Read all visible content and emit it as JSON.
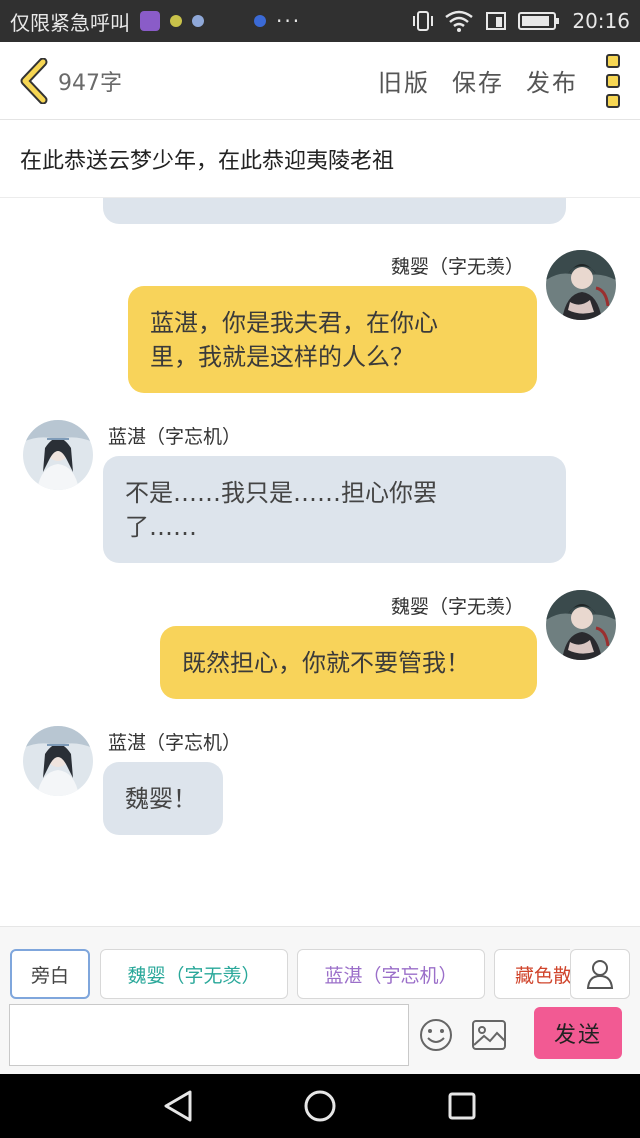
{
  "status_bar": {
    "carrier": "仅限紧急呼叫",
    "more": "···",
    "time": "20:16",
    "battery_level": 0.9
  },
  "toolbar": {
    "word_count": "947字",
    "actions": [
      "旧版",
      "保存",
      "发布"
    ]
  },
  "title": "在此恭送云梦少年，在此恭迎夷陵老祖",
  "messages": [
    {
      "side": "right",
      "speaker": "魏婴（字无羡）",
      "lines": [
        "蓝湛，你是我夫君，在你心",
        "里，我就是这样的人么？"
      ]
    },
    {
      "side": "left",
      "speaker": "蓝湛（字忘机）",
      "lines": [
        "不是……我只是……担心你罢",
        "了……"
      ]
    },
    {
      "side": "right",
      "speaker": "魏婴（字无羡）",
      "lines": [
        "既然担心，你就不要管我！"
      ]
    },
    {
      "side": "left",
      "speaker": "蓝湛（字忘机）",
      "lines": [
        "魏婴！"
      ]
    }
  ],
  "chips": [
    {
      "label": "旁白",
      "color": "#444444"
    },
    {
      "label": "魏婴（字无羡）",
      "color": "#2aa89a"
    },
    {
      "label": "蓝湛（字忘机）",
      "color": "#9b6fc9"
    },
    {
      "label": "藏色散人",
      "color": "#d0452c"
    }
  ],
  "composer": {
    "input_value": "",
    "input_placeholder": "",
    "send_label": "发送"
  },
  "colors": {
    "bubble_right": "#f8d35a",
    "bubble_left": "#dde4ec",
    "send_button": "#f25a93",
    "back_chevron": "#f6d653"
  },
  "icons": [
    "back-chevron-icon",
    "menu-icon",
    "profile-icon",
    "emoji-icon",
    "image-icon",
    "nav-back-icon",
    "nav-home-icon",
    "nav-recents-icon",
    "wifi-icon",
    "battery-icon",
    "signal-icon"
  ]
}
